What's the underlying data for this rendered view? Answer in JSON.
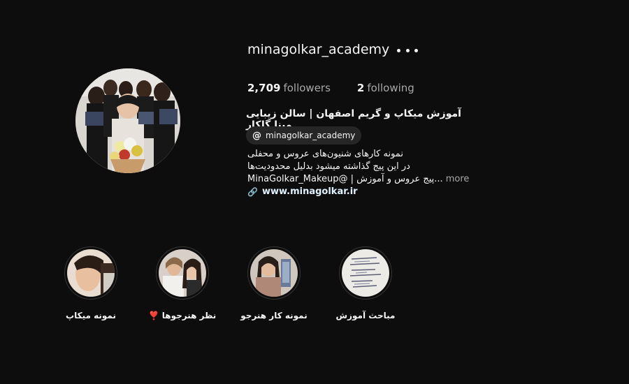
{
  "profile": {
    "username": "minagolkar_academy",
    "followers_count": "2,709",
    "followers_label": "followers",
    "following_count": "2",
    "following_label": "following",
    "display_name": "آموزش میکاپ و گریم اصفهان | سالن زیبایی مینا گلکار",
    "threads_handle": "minagolkar_academy",
    "bio_line1": "نمونه کارهای شنیون‌های عروس و محفلی",
    "bio_line2": "در این پیج گذاشته میشود بدلیل محدودیت‌ها",
    "bio_line3": "MinaGolkar_Makeup@ | پیج عروس و آموزش...",
    "more_label": "more",
    "website": "www.minagolkar.ir"
  },
  "highlights": [
    {
      "label": "نمونه میکاپ"
    },
    {
      "label": "نظر هنرجوها ❣️"
    },
    {
      "label": "نمونه کار هنرجو"
    },
    {
      "label": "مباحث آموزش"
    }
  ],
  "icons": {
    "more": "more-options-icon",
    "threads": "threads-icon",
    "link": "link-icon"
  }
}
